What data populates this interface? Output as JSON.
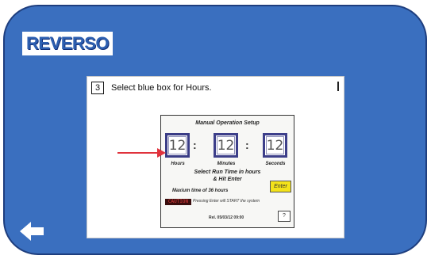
{
  "brand": {
    "logo_text": "REVERSO"
  },
  "slide": {
    "step_number": "3",
    "instruction": "Select blue box for Hours."
  },
  "panel": {
    "title": "Manual Operation Setup",
    "hours_value": "12",
    "minutes_value": "12",
    "seconds_value": "12",
    "separator": ":",
    "hours_label": "Hours",
    "minutes_label": "Minutes",
    "seconds_label": "Seconds",
    "select_line1": "Select Run Time in hours",
    "select_line2": "& Hit Enter",
    "max_time": "Maxium time of 36 hours",
    "enter_label": "Enter",
    "status_text": "CAUTION",
    "warning": "Pressing Enter will START the system",
    "ref": "Rel. 05/03/12 09:00",
    "help_label": "?"
  },
  "annotations": {
    "arrow_color": "#e0323c",
    "arrow_target": "hours-box"
  },
  "navigation": {
    "back_icon": "left-arrow-icon"
  },
  "colors": {
    "frame": "#3a6fbf",
    "logo_text": "#2d5fb0",
    "enter_button": "#f3e21a",
    "time_box_border": "#3d3f8a"
  }
}
